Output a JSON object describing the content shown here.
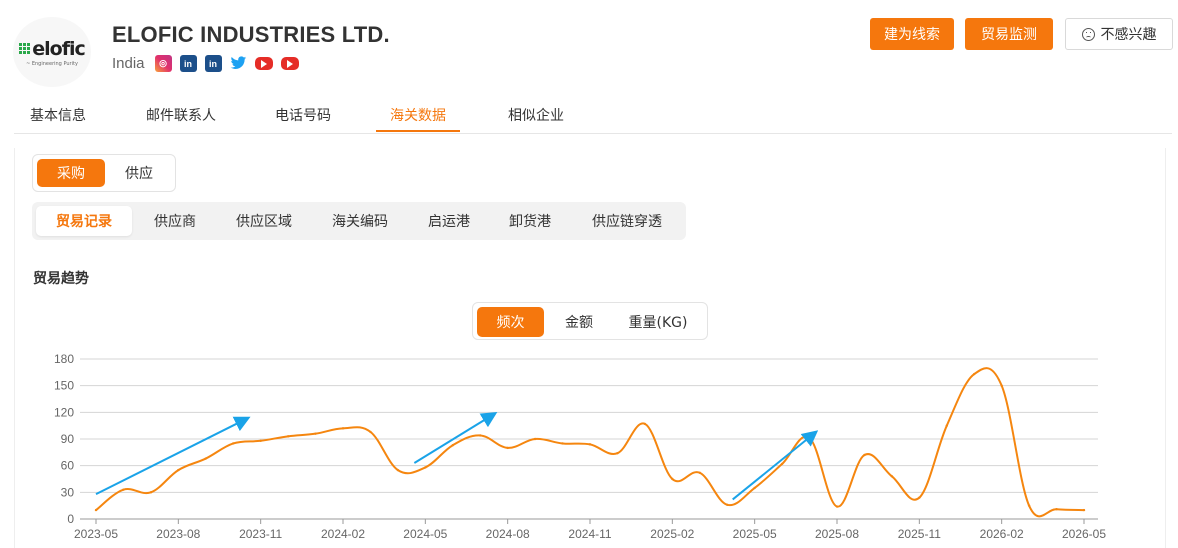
{
  "company": {
    "logo_text": "elofic",
    "logo_tagline": "~ Engineering Purity",
    "name": "ELOFIC INDUSTRIES LTD.",
    "country": "India",
    "social": [
      "instagram-icon",
      "linkedin-icon",
      "linkedin-icon",
      "twitter-icon",
      "youtube-icon",
      "youtube-icon"
    ],
    "social_labels": {
      "linkedin": "in",
      "instagram": "◎"
    }
  },
  "actions": {
    "create_lead": "建为线索",
    "trade_monitor": "贸易监测",
    "not_interested": "不感兴趣"
  },
  "main_tabs": [
    "基本信息",
    "邮件联系人",
    "电话号码",
    "海关数据",
    "相似企业"
  ],
  "main_tab_active": "海关数据",
  "direction_toggle": [
    "采购",
    "供应"
  ],
  "sub_tabs": [
    "贸易记录",
    "供应商",
    "供应区域",
    "海关编码",
    "启运港",
    "卸货港",
    "供应链穿透"
  ],
  "section_title": "贸易趋势",
  "metric_toggle": [
    "频次",
    "金额",
    "重量(KG)"
  ],
  "colors": {
    "accent": "#f5770d",
    "line": "#f5860f",
    "arrow": "#1aa3e8"
  },
  "chart_data": {
    "type": "line",
    "title": "",
    "xlabel": "",
    "ylabel": "",
    "ylim": [
      0,
      180
    ],
    "yticks": [
      0,
      30,
      60,
      90,
      120,
      150,
      180
    ],
    "xtick_labels": [
      "2023-05",
      "2023-08",
      "2023-11",
      "2024-02",
      "2024-05",
      "2024-08",
      "2024-11",
      "2025-02",
      "2025-05",
      "2025-08",
      "2025-11",
      "2026-02",
      "2026-05"
    ],
    "x": [
      "2023-05",
      "2023-06",
      "2023-07",
      "2023-08",
      "2023-09",
      "2023-10",
      "2023-11",
      "2023-12",
      "2024-01",
      "2024-02",
      "2024-03",
      "2024-04",
      "2024-05",
      "2024-06",
      "2024-07",
      "2024-08",
      "2024-09",
      "2024-10",
      "2024-11",
      "2024-12",
      "2025-01",
      "2025-02",
      "2025-03",
      "2025-04",
      "2025-05",
      "2025-06",
      "2025-07",
      "2025-08",
      "2025-09",
      "2025-10",
      "2025-11",
      "2025-12",
      "2026-01",
      "2026-02",
      "2026-03",
      "2026-04",
      "2026-05"
    ],
    "series": [
      {
        "values": [
          10,
          33,
          30,
          55,
          68,
          85,
          88,
          93,
          96,
          102,
          98,
          55,
          58,
          83,
          94,
          80,
          90,
          85,
          84,
          74,
          107,
          45,
          52,
          16,
          35,
          62,
          91,
          14,
          72,
          48,
          24,
          105,
          163,
          150,
          15,
          11,
          10
        ]
      }
    ],
    "grid": true,
    "legend": "none",
    "annotations": "three blue trend arrows"
  }
}
